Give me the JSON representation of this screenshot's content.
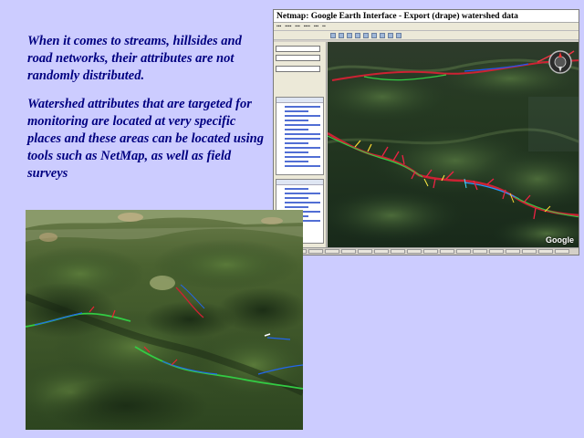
{
  "slide": {
    "paragraphs": [
      "When it comes to streams, hillsides and  road networks, their attributes are not randomly distributed.",
      "Watershed attributes that are targeted for monitoring are located at very specific places and these areas can be located using tools such as NetMap, as well as field surveys"
    ]
  },
  "screenshot": {
    "window_title": "Netmap: Google Earth Interface - Export (drape) watershed data",
    "logo_text": "Google"
  },
  "colors": {
    "background": "#ccccff",
    "text": "#000080"
  },
  "icons": [
    "compass-icon"
  ]
}
